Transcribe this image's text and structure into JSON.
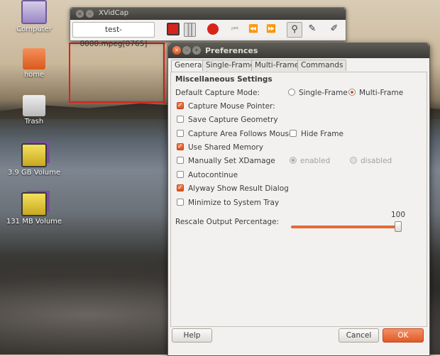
{
  "desktop": {
    "icons": [
      {
        "label": "Computer",
        "icon": "computer-icon"
      },
      {
        "label": "home",
        "icon": "home-folder-icon"
      },
      {
        "label": "Trash",
        "icon": "trash-icon"
      },
      {
        "label": "3.9 GB Volume",
        "icon": "drive-icon"
      },
      {
        "label": "131 MB Volume",
        "icon": "drive-icon"
      }
    ]
  },
  "xvidcap": {
    "title": "XVidCap",
    "close_glyph": "×",
    "min_glyph": "–",
    "filename": "test-0000.mpeg[0765]",
    "toolbar": {
      "step_back_glyph": "⏮",
      "back_glyph": "⏪",
      "forward_glyph": "⏩",
      "wand_glyph": "⚲",
      "edit_glyph": "✎",
      "pen_glyph": "✐"
    },
    "colors": {
      "record": "#d8231b"
    }
  },
  "prefs": {
    "title": "Preferences",
    "close_glyph": "×",
    "min_glyph": "–",
    "max_glyph": "+",
    "tabs": [
      "General",
      "Single-Frame",
      "Multi-Frame",
      "Commands"
    ],
    "active_tab": "General",
    "section": "Miscellaneous Settings",
    "capture_mode": {
      "label": "Default Capture Mode:",
      "options": [
        "Single-Frame",
        "Multi-Frame"
      ],
      "selected": "Multi-Frame"
    },
    "options": {
      "capture_mouse": {
        "label": "Capture Mouse Pointer:",
        "checked": true
      },
      "save_geometry": {
        "label": "Save Capture Geometry",
        "checked": false
      },
      "follows_mouse": {
        "label": "Capture Area Follows Mouse",
        "checked": false
      },
      "hide_frame": {
        "label": "Hide Frame",
        "checked": false
      },
      "shared_memory": {
        "label": "Use Shared Memory",
        "checked": true
      },
      "xdamage": {
        "label": "Manually Set XDamage",
        "checked": false
      },
      "xdamage_enabled": "enabled",
      "xdamage_disabled": "disabled",
      "autocontinue": {
        "label": "Autocontinue",
        "checked": false
      },
      "show_result": {
        "label": "Alyway Show Result Dialog",
        "checked": true
      },
      "minimize_tray": {
        "label": "Minimize to System Tray",
        "checked": false
      }
    },
    "rescale": {
      "label": "Rescale Output Percentage:",
      "value": "100",
      "fraction": 1.0
    },
    "buttons": {
      "help": "Help",
      "cancel": "Cancel",
      "ok": "OK"
    },
    "colors": {
      "accent": "#e05a24"
    }
  }
}
